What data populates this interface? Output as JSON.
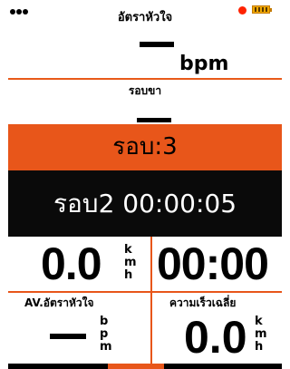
{
  "status": {
    "title": "อัตราหัวใจ",
    "recording_color": "#ff2200",
    "battery_color": "#f0a800"
  },
  "heart_rate": {
    "value": "--",
    "unit": "bpm"
  },
  "cadence": {
    "title": "รอบขา",
    "value": "--"
  },
  "lap": {
    "label": "รอบ:3"
  },
  "lap_time": {
    "label": "รอบ2 00:00:05"
  },
  "speed": {
    "value": "0.0",
    "unit": [
      "k",
      "m",
      "h"
    ]
  },
  "timer": {
    "value": "00:00"
  },
  "avg_hr": {
    "title": "AV.อัตราหัวใจ",
    "value": "--",
    "unit": [
      "b",
      "p",
      "m"
    ]
  },
  "avg_speed": {
    "title": "ความเร็วเฉลี่ย",
    "value": "0.0",
    "unit": [
      "k",
      "m",
      "h"
    ]
  }
}
